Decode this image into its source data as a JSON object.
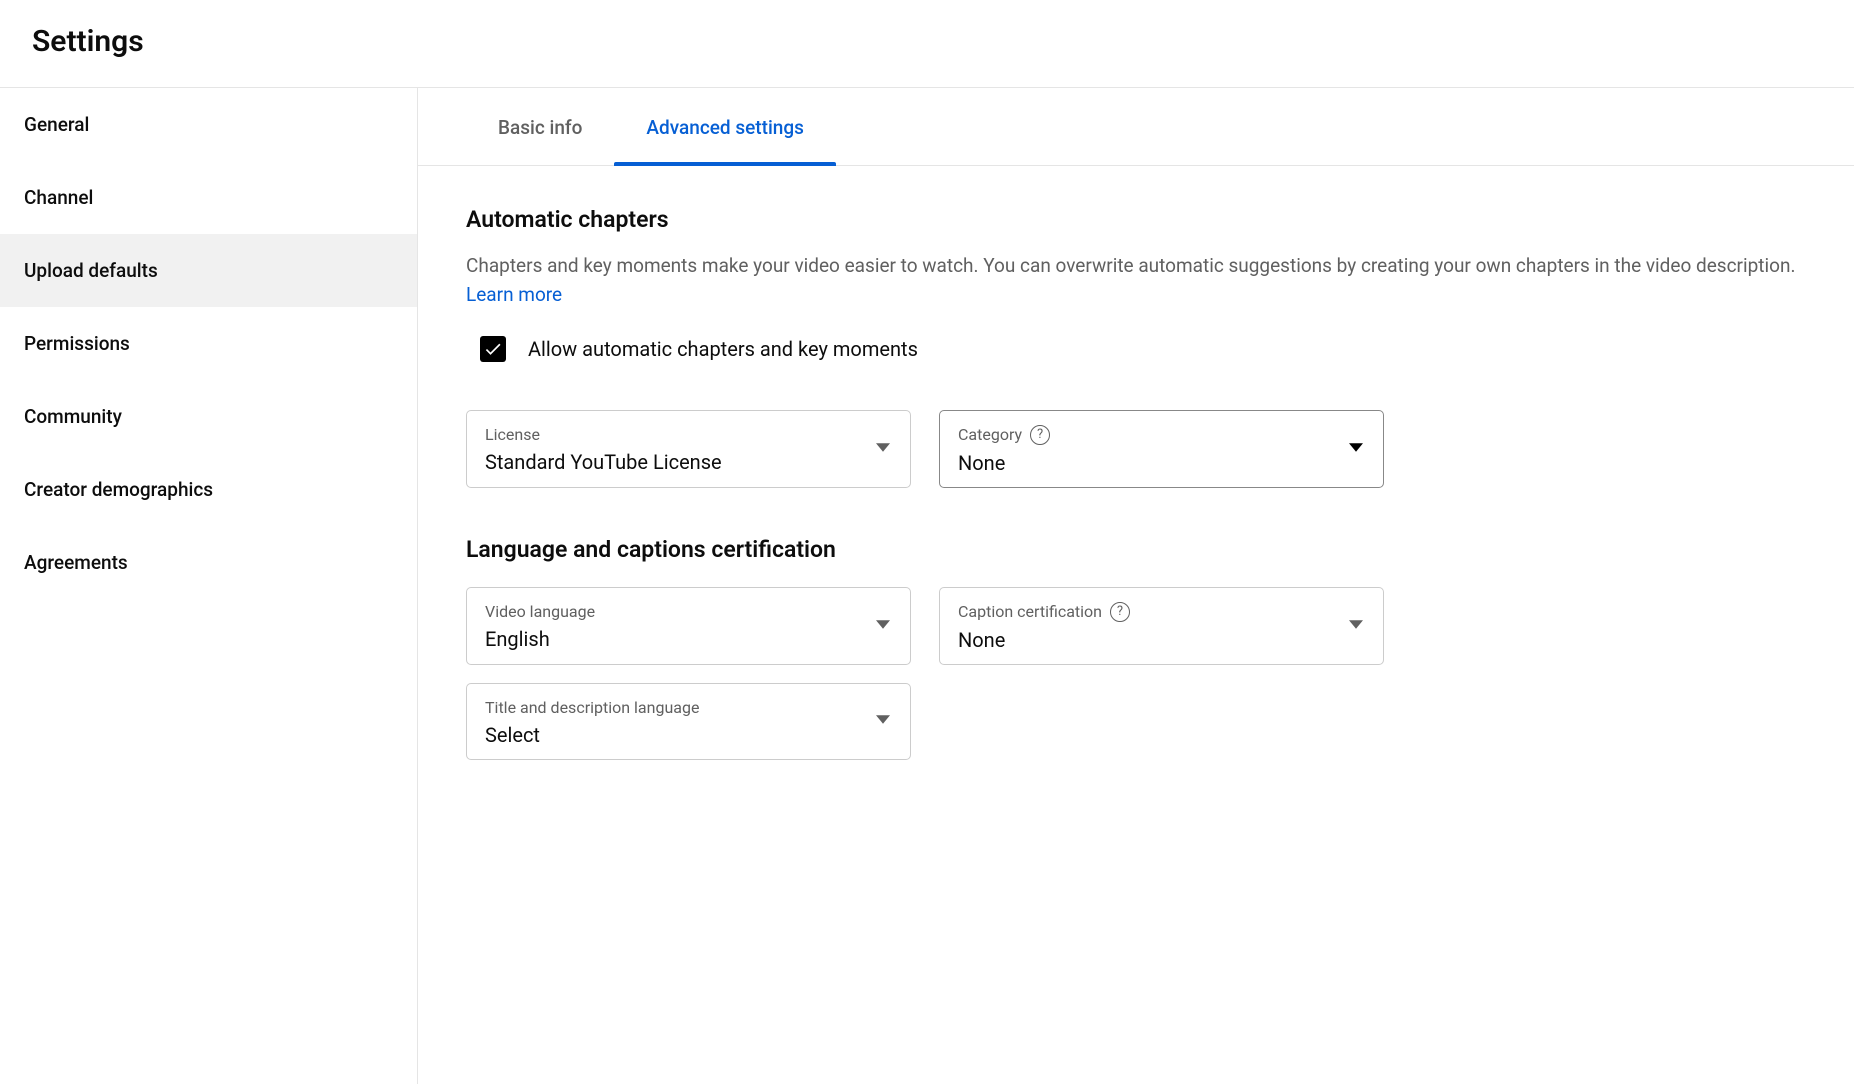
{
  "header": {
    "title": "Settings"
  },
  "sidebar": {
    "items": [
      {
        "label": "General"
      },
      {
        "label": "Channel"
      },
      {
        "label": "Upload defaults"
      },
      {
        "label": "Permissions"
      },
      {
        "label": "Community"
      },
      {
        "label": "Creator demographics"
      },
      {
        "label": "Agreements"
      }
    ]
  },
  "tabs": {
    "basic": "Basic info",
    "advanced": "Advanced settings"
  },
  "content": {
    "autoChapters": {
      "title": "Automatic chapters",
      "desc": "Chapters and key moments make your video easier to watch. You can overwrite automatic suggestions by creating your own chapters in the video description. ",
      "learnMore": "Learn more",
      "checkboxLabel": "Allow automatic chapters and key moments"
    },
    "license": {
      "label": "License",
      "value": "Standard YouTube License"
    },
    "category": {
      "label": "Category",
      "value": "None"
    },
    "langSection": {
      "title": "Language and captions certification"
    },
    "videoLang": {
      "label": "Video language",
      "value": "English"
    },
    "captionCert": {
      "label": "Caption certification",
      "value": "None"
    },
    "titleDescLang": {
      "label": "Title and description language",
      "value": "Select"
    }
  }
}
